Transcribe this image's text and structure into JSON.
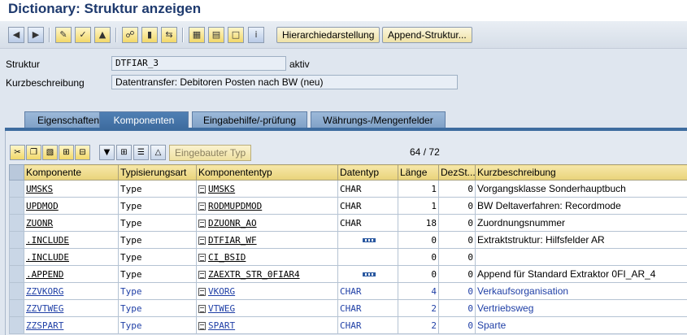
{
  "window": {
    "title": "Dictionary: Struktur anzeigen"
  },
  "toolbar": {
    "hierarchy_label": "Hierarchiedarstellung",
    "append_label": "Append-Struktur..."
  },
  "header": {
    "struktur_label": "Struktur",
    "struktur_value": "DTFIAR_3",
    "status": "aktiv",
    "kurz_label": "Kurzbeschreibung",
    "kurz_value": "Datentransfer: Debitoren Posten nach BW (neu)"
  },
  "tabs": [
    {
      "label": "Eigenschaften",
      "active": false
    },
    {
      "label": "Komponenten",
      "active": true
    },
    {
      "label": "Eingabehilfe/-prüfung",
      "active": false
    },
    {
      "label": "Währungs-/Mengenfelder",
      "active": false
    }
  ],
  "panel": {
    "builtin_type_label": "Eingebauter Typ",
    "counter_current": "64",
    "counter_sep": "/",
    "counter_total": "72"
  },
  "grid": {
    "columns": [
      "Komponente",
      "Typisierungsart",
      "Komponententyp",
      "Datentyp",
      "Länge",
      "DezSt...",
      "Kurzbeschreibung"
    ],
    "rows": [
      {
        "komponente": "UMSKS",
        "typ": "Type",
        "komptyp": "UMSKS",
        "datentyp": "CHAR",
        "laenge": "1",
        "dez": "0",
        "kurz": "Vorgangsklasse Sonderhauptbuch",
        "blue": false,
        "dots": false
      },
      {
        "komponente": "UPDMOD",
        "typ": "Type",
        "komptyp": "RODMUPDMOD",
        "datentyp": "CHAR",
        "laenge": "1",
        "dez": "0",
        "kurz": "BW Deltaverfahren: Recordmode",
        "blue": false,
        "dots": false
      },
      {
        "komponente": "ZUONR",
        "typ": "Type",
        "komptyp": "DZUONR_AO",
        "datentyp": "CHAR",
        "laenge": "18",
        "dez": "0",
        "kurz": "Zuordnungsnummer",
        "blue": false,
        "dots": false
      },
      {
        "komponente": ".INCLUDE",
        "typ": "Type",
        "komptyp": "DTFIAR_WF",
        "datentyp": "",
        "laenge": "0",
        "dez": "0",
        "kurz": "Extraktstruktur: Hilfsfelder AR",
        "blue": false,
        "dots": true
      },
      {
        "komponente": ".INCLUDE",
        "typ": "Type",
        "komptyp": "CI_BSID",
        "datentyp": "",
        "laenge": "0",
        "dez": "0",
        "kurz": "",
        "blue": false,
        "dots": false
      },
      {
        "komponente": ".APPEND",
        "typ": "Type",
        "komptyp": "ZAEXTR_STR_0FIAR4",
        "datentyp": "",
        "laenge": "0",
        "dez": "0",
        "kurz": "Append für Standard Extraktor 0FI_AR_4",
        "blue": false,
        "dots": true
      },
      {
        "komponente": "ZZVKORG",
        "typ": "Type",
        "komptyp": "VKORG",
        "datentyp": "CHAR",
        "laenge": "4",
        "dez": "0",
        "kurz": "Verkaufsorganisation",
        "blue": true,
        "dots": false
      },
      {
        "komponente": "ZZVTWEG",
        "typ": "Type",
        "komptyp": "VTWEG",
        "datentyp": "CHAR",
        "laenge": "2",
        "dez": "0",
        "kurz": "Vertriebsweg",
        "blue": true,
        "dots": false
      },
      {
        "komponente": "ZZSPART",
        "typ": "Type",
        "komptyp": "SPART",
        "datentyp": "CHAR",
        "laenge": "2",
        "dez": "0",
        "kurz": "Sparte",
        "blue": true,
        "dots": false
      }
    ]
  },
  "icons": {
    "back": "arrow-left-icon",
    "forward": "arrow-right-icon",
    "edit": "pencil-glasses-icon",
    "check": "check-icon",
    "where_used": "where-used-icon",
    "hierarchy": "hierarchy-icon",
    "info": "info-icon"
  }
}
